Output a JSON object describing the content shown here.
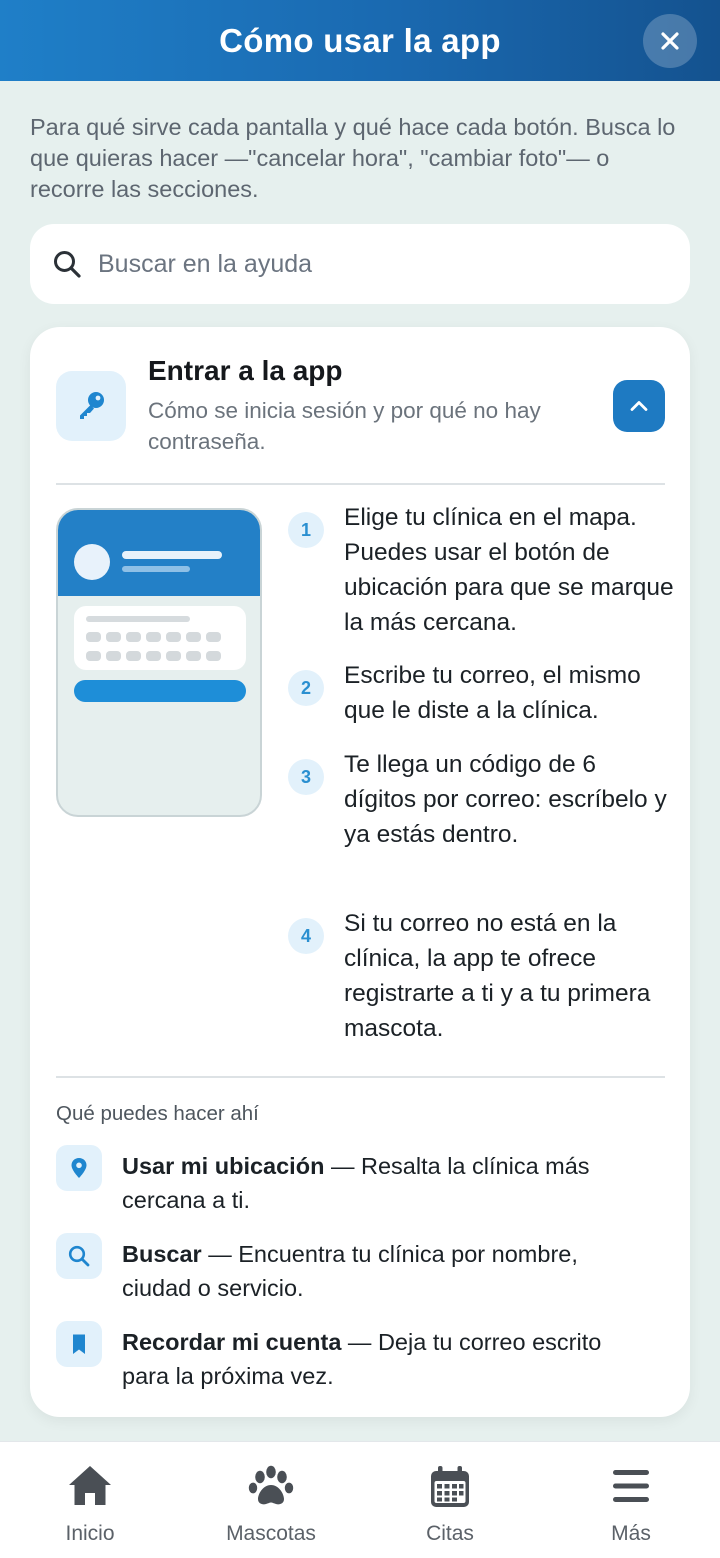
{
  "header": {
    "title": "Cómo usar la app",
    "close_icon": "close-icon"
  },
  "intro": "Para qué sirve cada pantalla y qué hace cada botón. Busca lo que quieras hacer —\"cancelar hora\", \"cambiar foto\"— o recorre las secciones.",
  "search": {
    "placeholder": "Buscar en la ayuda",
    "icon": "search-icon"
  },
  "section": {
    "icon": "key-icon",
    "title": "Entrar a la app",
    "subtitle": "Cómo se inicia sesión y por qué no hay contraseña.",
    "expanded": true,
    "steps": [
      {
        "number": "1",
        "text": "Elige tu clínica en el mapa. Puedes usar el botón de ubicación para que se marque la más cercana."
      },
      {
        "number": "2",
        "text": "Escribe tu correo, el mismo que le diste a la clínica."
      },
      {
        "number": "3",
        "text": "Te llega un código de 6 dígitos por correo: escríbelo y ya estás dentro."
      },
      {
        "number": "4",
        "text": "Si tu correo no está en la clínica, la app te ofrece registrarte a ti y a tu primera mascota."
      }
    ],
    "can_do_title": "Qué puedes hacer ahí",
    "features": [
      {
        "icon": "location-pin-icon",
        "name": "Usar mi ubicación",
        "desc": " — Resalta la clínica más cercana a ti."
      },
      {
        "icon": "search-icon",
        "name": "Buscar",
        "desc": " — Encuentra tu clínica por nombre, ciudad o servicio."
      },
      {
        "icon": "bookmark-icon",
        "name": "Recordar mi cuenta",
        "desc": " — Deja tu correo escrito para la próxima vez."
      }
    ]
  },
  "nav": [
    {
      "label": "Inicio",
      "icon": "home-icon"
    },
    {
      "label": "Mascotas",
      "icon": "paw-icon"
    },
    {
      "label": "Citas",
      "icon": "calendar-icon"
    },
    {
      "label": "Más",
      "icon": "menu-icon"
    }
  ],
  "colors": {
    "accent": "#1e7ac2",
    "header_start": "#1f7fc8",
    "header_end": "#14528f",
    "background": "#e6f0ee",
    "icon_bg": "#e2f1fb"
  }
}
